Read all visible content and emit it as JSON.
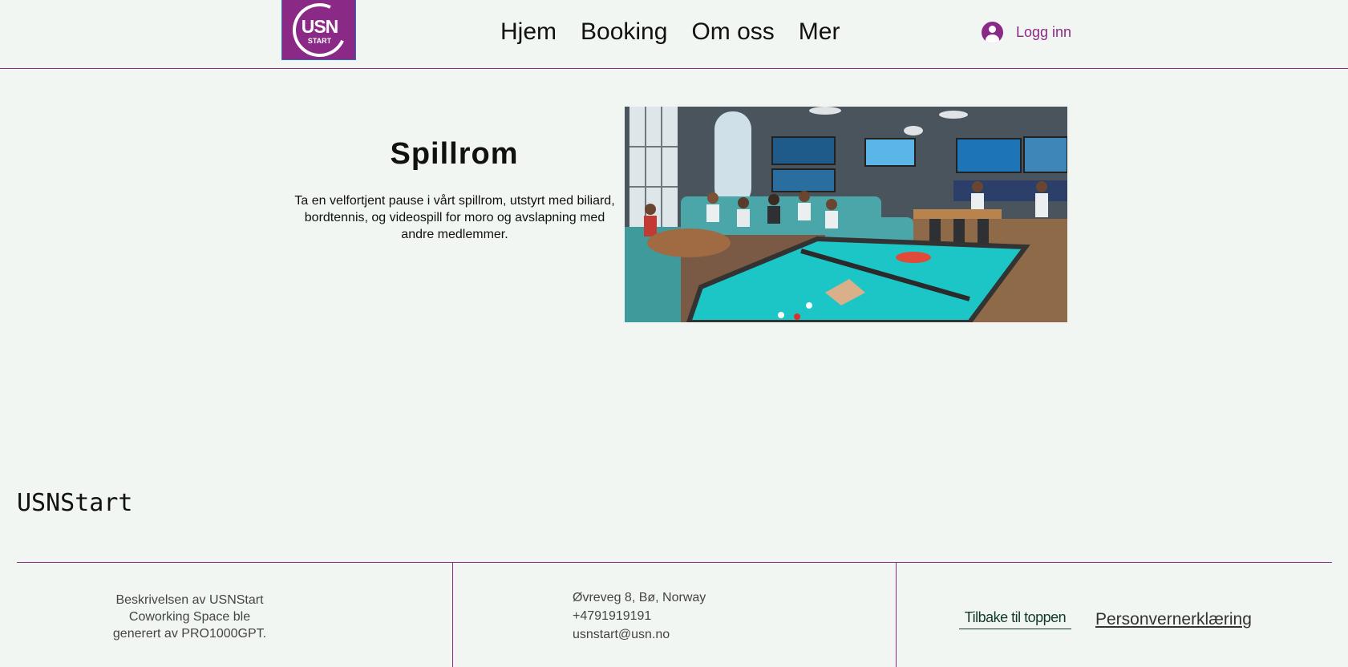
{
  "header": {
    "logo": {
      "main": "USN",
      "sub": "START",
      "color": "#8b2a86"
    },
    "nav": [
      "Hjem",
      "Booking",
      "Om oss",
      "Mer"
    ],
    "login_label": "Logg inn"
  },
  "main": {
    "title": "Spillrom",
    "description": "Ta en velfortjent pause i vårt spillrom, utstyrt med biliard, bordtennis, og videospill for moro og avslapning med andre medlemmer.",
    "image_alt": "spillrom-illustrasjon"
  },
  "footer": {
    "brand": "USNStart",
    "description": "Beskrivelsen av USNStart Coworking Space ble generert av PRO1000GPT.",
    "address": "Øvreveg 8, Bø, Norway",
    "phone": "+4791919191",
    "email": "usnstart@usn.no",
    "back_to_top": "Tilbake til toppen",
    "privacy": "Personvernerklæring"
  },
  "colors": {
    "accent": "#8b2a86",
    "background": "#f2f6f2",
    "footer_link": "#0f3a2a"
  }
}
